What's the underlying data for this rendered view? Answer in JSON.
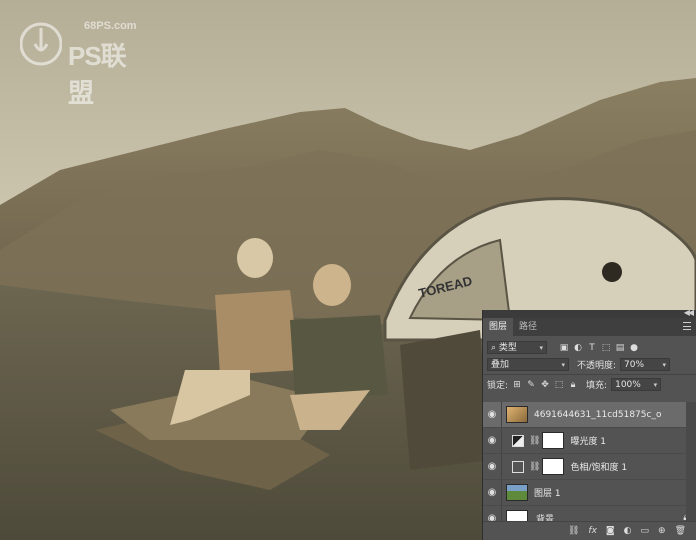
{
  "watermark": {
    "site": "68PS.com",
    "name": "PS联盟"
  },
  "tent": {
    "brand": "TOREAD"
  },
  "panel": {
    "tabs": [
      {
        "label": "图层"
      },
      {
        "label": "路径"
      }
    ],
    "filter": {
      "kind_label": "类型"
    },
    "blend": {
      "mode": "叠加",
      "opacity_label": "不透明度:",
      "opacity_value": "70%"
    },
    "lock": {
      "label": "锁定:",
      "fill_label": "填充:",
      "fill_value": "100%"
    },
    "layers": [
      {
        "name": "4691644631_11cd51875c_o",
        "selected": true
      },
      {
        "name": "曝光度 1"
      },
      {
        "name": "色相/饱和度 1"
      },
      {
        "name": "图层 1"
      },
      {
        "name": "背景"
      }
    ],
    "footer": {
      "fx_label": "fx"
    }
  },
  "colors": {
    "panel_bg": "#535353",
    "tabbar_bg": "#3f3f3f",
    "selected_layer": "#6b6b6b",
    "photo_tone": "#a59a7c"
  }
}
